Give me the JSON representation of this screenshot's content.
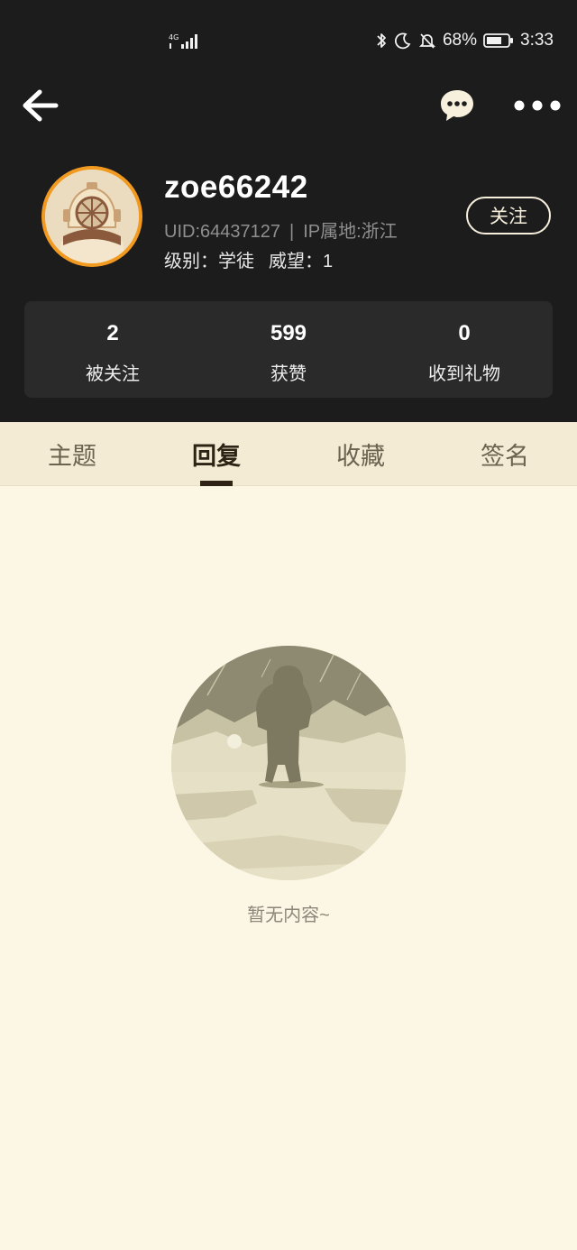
{
  "status_bar": {
    "network": "4G",
    "battery": "68%",
    "time": "3:33"
  },
  "nav": {
    "back_icon": "back-arrow-icon",
    "chat_icon": "chat-bubble-icon",
    "more_icon": "more-dots-icon"
  },
  "profile": {
    "username": "zoe66242",
    "uid": "UID:64437127",
    "ip": "IP属地:浙江",
    "level": "级别：学徒",
    "prestige": "威望：1",
    "follow_label": "关注",
    "avatar_accent": "#f19a1f"
  },
  "stats": [
    {
      "value": "2",
      "label": "被关注"
    },
    {
      "value": "599",
      "label": "获赞"
    },
    {
      "value": "0",
      "label": "收到礼物"
    }
  ],
  "tabs": [
    {
      "label": "主题",
      "active": false
    },
    {
      "label": "回复",
      "active": true
    },
    {
      "label": "收藏",
      "active": false
    },
    {
      "label": "签名",
      "active": false
    }
  ],
  "empty": {
    "text": "暂无内容~"
  },
  "colors": {
    "header_bg": "#1c1c1c",
    "page_bg": "#fcf7e4",
    "tab_bg": "#f3ebd3",
    "active_tab": "#2e2314"
  }
}
